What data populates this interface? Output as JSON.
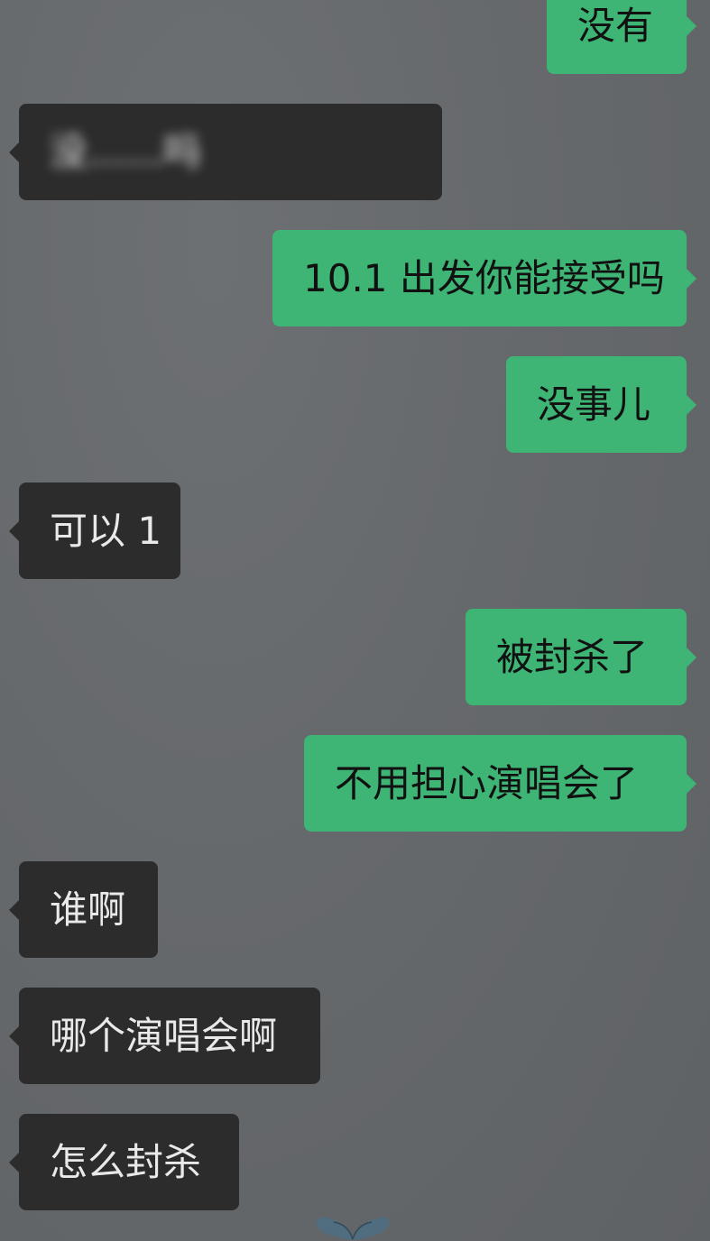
{
  "messages": [
    {
      "side": "out",
      "text": "没有"
    },
    {
      "side": "in",
      "text": "没……吗",
      "redacted": true
    },
    {
      "side": "out",
      "text": "10.1 出发你能接受吗"
    },
    {
      "side": "out",
      "text": "没事儿"
    },
    {
      "side": "in",
      "text": "可以 1"
    },
    {
      "side": "out",
      "text": "被封杀了"
    },
    {
      "side": "out",
      "text": "不用担心演唱会了"
    },
    {
      "side": "in",
      "text": "谁啊"
    },
    {
      "side": "in",
      "text": "哪个演唱会啊"
    },
    {
      "side": "in",
      "text": "怎么封杀"
    }
  ],
  "colors": {
    "outgoing_bubble": "#3eb575",
    "incoming_bubble": "#2c2c2c",
    "background": "#66696c"
  },
  "icons": {
    "bottom_decoration": "butterfly-icon"
  }
}
